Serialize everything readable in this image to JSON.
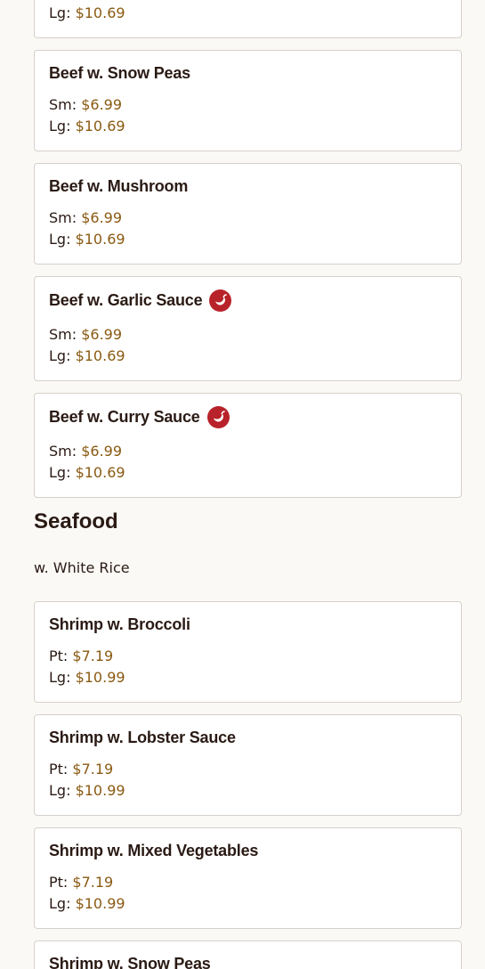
{
  "colors": {
    "background": "#fbf9f6",
    "card_border": "#d6d0cb",
    "price": "#8a5a12",
    "spicy": "#b8222a"
  },
  "beef_items": [
    {
      "name": "",
      "prices": [
        {
          "label": "Lg:",
          "value": "$10.69"
        }
      ]
    },
    {
      "name": "Beef w. Snow Peas",
      "spicy": false,
      "prices": [
        {
          "label": "Sm:",
          "value": "$6.99"
        },
        {
          "label": "Lg:",
          "value": "$10.69"
        }
      ]
    },
    {
      "name": "Beef w. Mushroom",
      "spicy": false,
      "prices": [
        {
          "label": "Sm:",
          "value": "$6.99"
        },
        {
          "label": "Lg:",
          "value": "$10.69"
        }
      ]
    },
    {
      "name": "Beef w. Garlic Sauce",
      "spicy": true,
      "icon": "spicy-pepper-icon",
      "prices": [
        {
          "label": "Sm:",
          "value": "$6.99"
        },
        {
          "label": "Lg:",
          "value": "$10.69"
        }
      ]
    },
    {
      "name": "Beef w. Curry Sauce",
      "spicy": true,
      "icon": "spicy-pepper-icon",
      "prices": [
        {
          "label": "Sm:",
          "value": "$6.99"
        },
        {
          "label": "Lg:",
          "value": "$10.69"
        }
      ]
    }
  ],
  "seafood": {
    "title": "Seafood",
    "subtitle": "w. White Rice",
    "items": [
      {
        "name": "Shrimp w. Broccoli",
        "prices": [
          {
            "label": "Pt:",
            "value": "$7.19"
          },
          {
            "label": "Lg:",
            "value": "$10.99"
          }
        ]
      },
      {
        "name": "Shrimp w. Lobster Sauce",
        "prices": [
          {
            "label": "Pt:",
            "value": "$7.19"
          },
          {
            "label": "Lg:",
            "value": "$10.99"
          }
        ]
      },
      {
        "name": "Shrimp w. Mixed Vegetables",
        "prices": [
          {
            "label": "Pt:",
            "value": "$7.19"
          },
          {
            "label": "Lg:",
            "value": "$10.99"
          }
        ]
      },
      {
        "name": "Shrimp w. Snow Peas",
        "prices": []
      }
    ]
  }
}
